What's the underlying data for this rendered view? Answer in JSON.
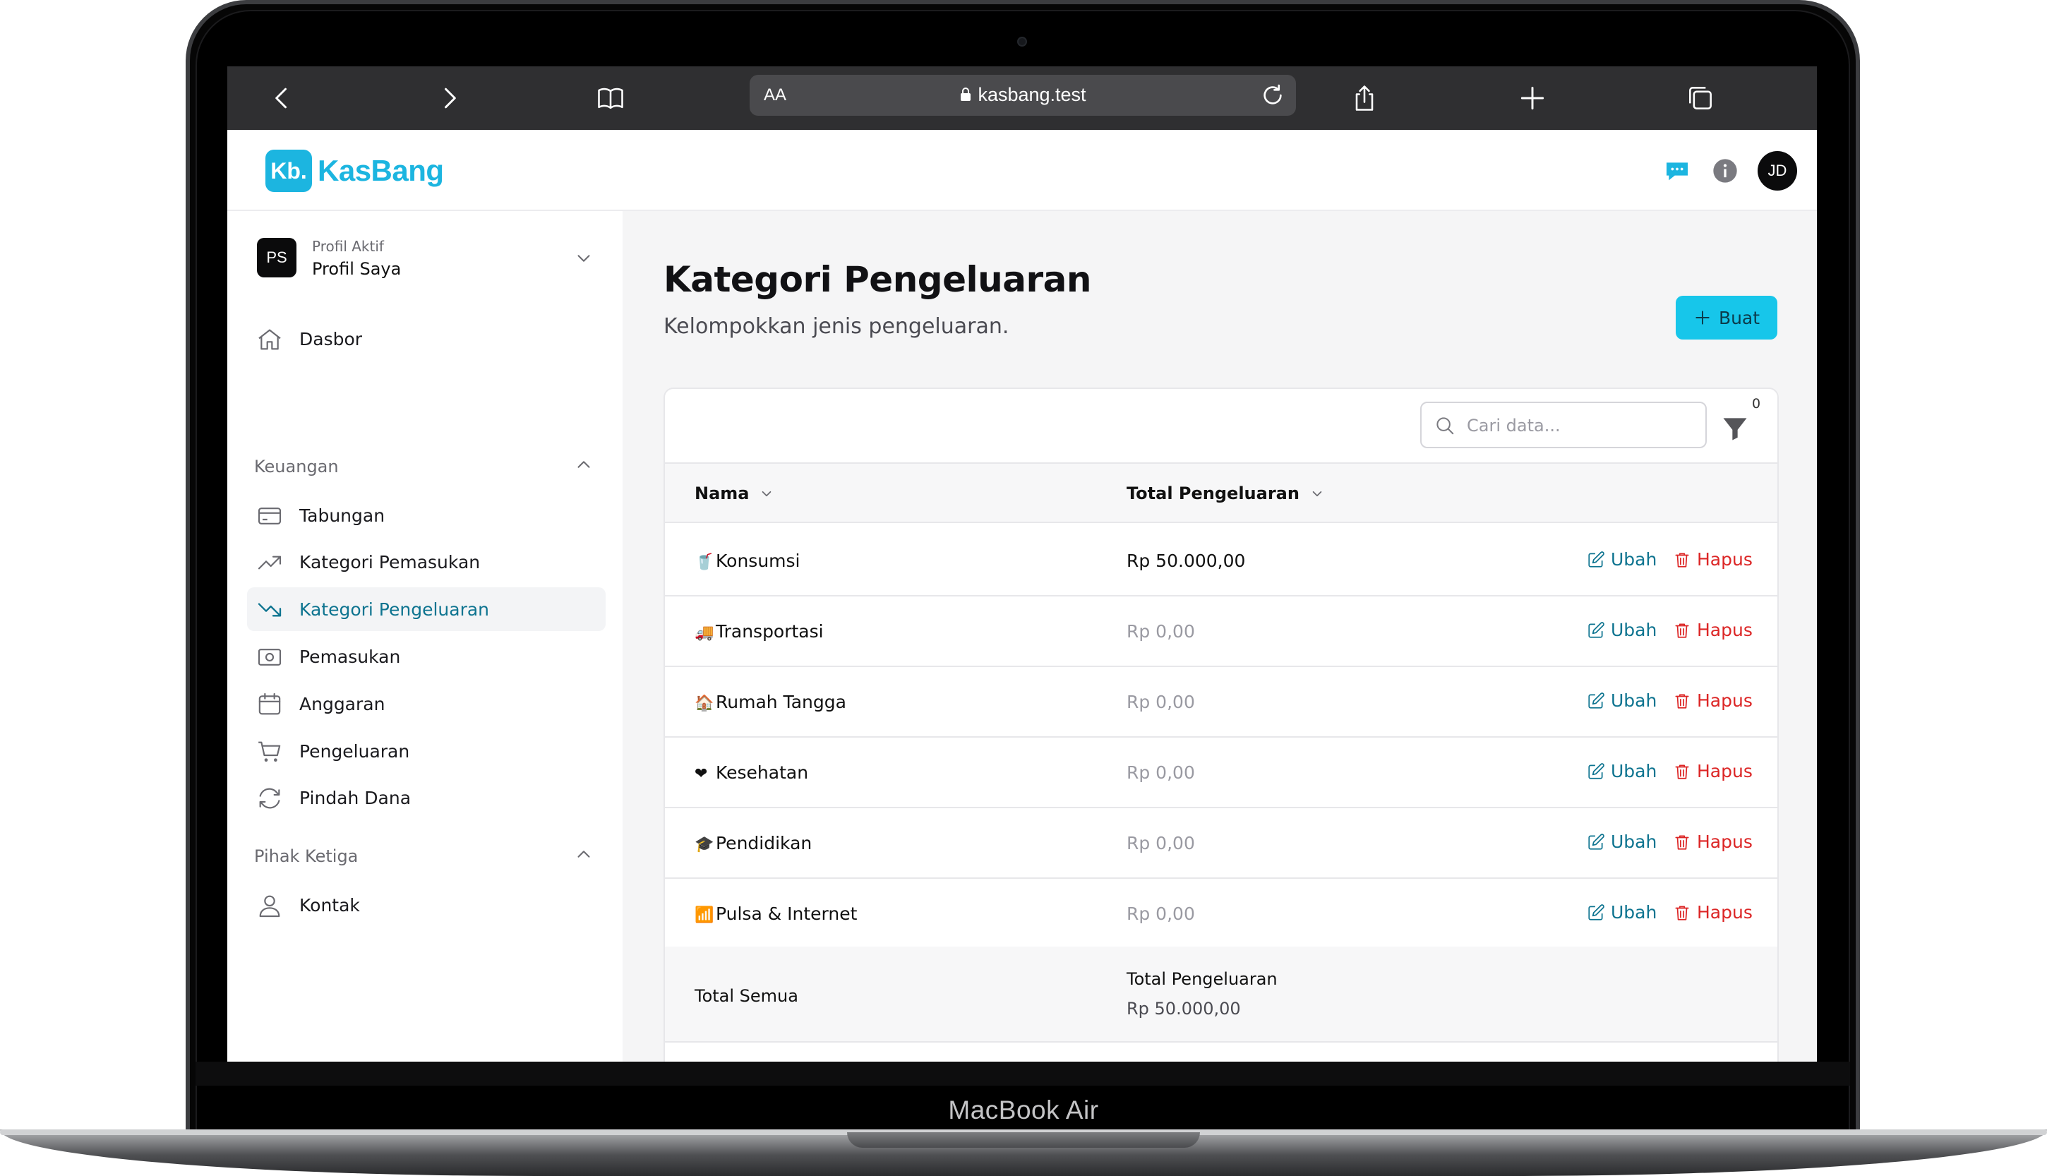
{
  "browser": {
    "reader_label": "AA",
    "url": "kasbang.test"
  },
  "brand": {
    "logo_mark": "Kb.",
    "logo_text": "KasBang",
    "accent": "#1cb5e0"
  },
  "header": {
    "avatar_initials": "JD"
  },
  "profile": {
    "badge": "PS",
    "caption": "Profil Aktif",
    "name": "Profil Saya"
  },
  "sidebar": {
    "dashboard": "Dasbor",
    "group_finance": "Keuangan",
    "finance_items": [
      {
        "label": "Tabungan",
        "icon": "card-icon"
      },
      {
        "label": "Kategori Pemasukan",
        "icon": "trend-up-icon"
      },
      {
        "label": "Kategori Pengeluaran",
        "icon": "trend-down-icon",
        "active": true
      },
      {
        "label": "Pemasukan",
        "icon": "cash-icon"
      },
      {
        "label": "Anggaran",
        "icon": "calendar-icon"
      },
      {
        "label": "Pengeluaran",
        "icon": "cart-icon"
      },
      {
        "label": "Pindah Dana",
        "icon": "transfer-icon"
      }
    ],
    "group_third_party": "Pihak Ketiga",
    "third_party_items": [
      {
        "label": "Kontak",
        "icon": "user-icon"
      }
    ]
  },
  "page": {
    "title": "Kategori Pengeluaran",
    "subtitle": "Kelompokkan jenis pengeluaran.",
    "create_label": "Buat"
  },
  "table": {
    "search_placeholder": "Cari data...",
    "filter_count": "0",
    "columns": [
      "Nama",
      "Total Pengeluaran"
    ],
    "edit_label": "Ubah",
    "delete_label": "Hapus",
    "rows": [
      {
        "emoji": "🥤",
        "name": "Konsumsi",
        "total": "Rp 50.000,00",
        "zero": false
      },
      {
        "emoji": "🚚",
        "name": "Transportasi",
        "total": "Rp 0,00",
        "zero": true
      },
      {
        "emoji": "🏠",
        "name": "Rumah Tangga",
        "total": "Rp 0,00",
        "zero": true
      },
      {
        "emoji": "❤",
        "name": "Kesehatan",
        "total": "Rp 0,00",
        "zero": true
      },
      {
        "emoji": "🎓",
        "name": "Pendidikan",
        "total": "Rp 0,00",
        "zero": true
      },
      {
        "emoji": "📶",
        "name": "Pulsa & Internet",
        "total": "Rp 0,00",
        "zero": true
      }
    ],
    "footer": {
      "label": "Total Semua",
      "total_heading": "Total Pengeluaran",
      "total_value": "Rp 50.000,00"
    }
  },
  "device": {
    "label": "MacBook Air"
  }
}
